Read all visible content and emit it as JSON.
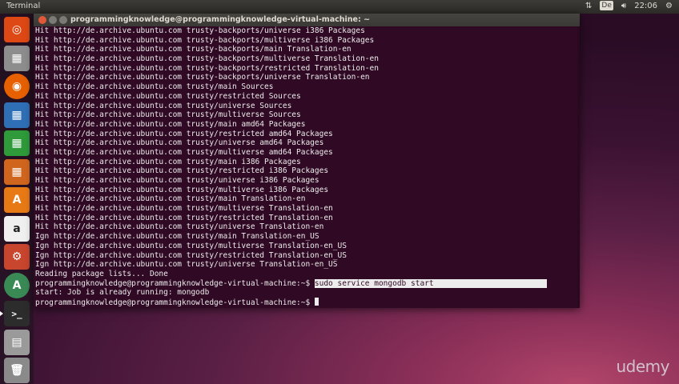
{
  "panel": {
    "app_name": "Terminal",
    "keyboard_layout": "De",
    "clock": "22:06"
  },
  "launcher": {
    "items": [
      {
        "name": "dash-home",
        "icon": "ubuntu-logo-icon",
        "color": "#dd4814"
      },
      {
        "name": "files",
        "icon": "file-manager-icon",
        "color": "#8d8d8d"
      },
      {
        "name": "firefox",
        "icon": "firefox-icon",
        "color": "#e66000"
      },
      {
        "name": "writer",
        "icon": "libreoffice-writer-icon",
        "color": "#2e6fb6"
      },
      {
        "name": "calc",
        "icon": "libreoffice-calc-icon",
        "color": "#2e9a3a"
      },
      {
        "name": "impress",
        "icon": "libreoffice-impress-icon",
        "color": "#d0661e"
      },
      {
        "name": "software-center",
        "icon": "software-center-icon",
        "color": "#e87a16"
      },
      {
        "name": "amazon",
        "icon": "amazon-icon",
        "color": "#f0f0f0"
      },
      {
        "name": "settings",
        "icon": "system-settings-icon",
        "color": "#c8452e"
      },
      {
        "name": "updater",
        "icon": "software-updater-icon",
        "color": "#3a8a56"
      },
      {
        "name": "terminal",
        "icon": "terminal-icon",
        "color": "#2c2c2c"
      },
      {
        "name": "removable-drive",
        "icon": "usb-drive-icon",
        "color": "#9a9a9a"
      },
      {
        "name": "trash",
        "icon": "trash-icon",
        "color": "#8a8a8a"
      }
    ]
  },
  "window": {
    "title": "programmingknowledge@programmingknowledge-virtual-machine: ~"
  },
  "terminal": {
    "lines": [
      "Hit http://de.archive.ubuntu.com trusty-backports/universe i386 Packages",
      "Hit http://de.archive.ubuntu.com trusty-backports/multiverse i386 Packages",
      "Hit http://de.archive.ubuntu.com trusty-backports/main Translation-en",
      "Hit http://de.archive.ubuntu.com trusty-backports/multiverse Translation-en",
      "Hit http://de.archive.ubuntu.com trusty-backports/restricted Translation-en",
      "Hit http://de.archive.ubuntu.com trusty-backports/universe Translation-en",
      "Hit http://de.archive.ubuntu.com trusty/main Sources",
      "Hit http://de.archive.ubuntu.com trusty/restricted Sources",
      "Hit http://de.archive.ubuntu.com trusty/universe Sources",
      "Hit http://de.archive.ubuntu.com trusty/multiverse Sources",
      "Hit http://de.archive.ubuntu.com trusty/main amd64 Packages",
      "Hit http://de.archive.ubuntu.com trusty/restricted amd64 Packages",
      "Hit http://de.archive.ubuntu.com trusty/universe amd64 Packages",
      "Hit http://de.archive.ubuntu.com trusty/multiverse amd64 Packages",
      "Hit http://de.archive.ubuntu.com trusty/main i386 Packages",
      "Hit http://de.archive.ubuntu.com trusty/restricted i386 Packages",
      "Hit http://de.archive.ubuntu.com trusty/universe i386 Packages",
      "Hit http://de.archive.ubuntu.com trusty/multiverse i386 Packages",
      "Hit http://de.archive.ubuntu.com trusty/main Translation-en",
      "Hit http://de.archive.ubuntu.com trusty/multiverse Translation-en",
      "Hit http://de.archive.ubuntu.com trusty/restricted Translation-en",
      "Hit http://de.archive.ubuntu.com trusty/universe Translation-en",
      "Ign http://de.archive.ubuntu.com trusty/main Translation-en_US",
      "Ign http://de.archive.ubuntu.com trusty/multiverse Translation-en_US",
      "Ign http://de.archive.ubuntu.com trusty/restricted Translation-en_US",
      "Ign http://de.archive.ubuntu.com trusty/universe Translation-en_US",
      "Reading package lists... Done"
    ],
    "prompt": "programmingknowledge@programmingknowledge-virtual-machine:~$ ",
    "command": "sudo service mongodb start",
    "output": "start: Job is already running: mongodb",
    "prompt2": "programmingknowledge@programmingknowledge-virtual-machine:~$ "
  },
  "watermark": "udemy"
}
